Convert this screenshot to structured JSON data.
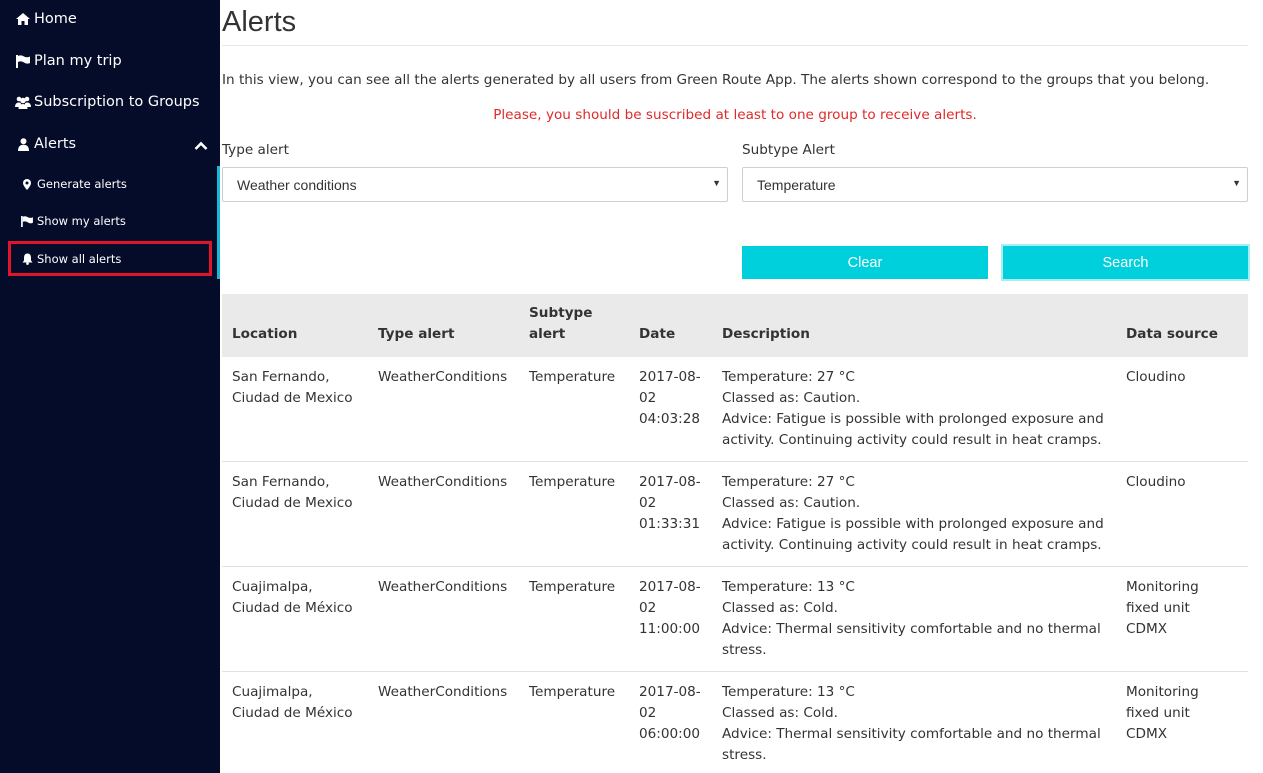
{
  "sidebar": {
    "home": "Home",
    "plan_trip": "Plan my trip",
    "subscription": "Subscription to Groups",
    "alerts": "Alerts",
    "sub_items": {
      "generate": "Generate alerts",
      "show_mine": "Show my alerts",
      "show_all": "Show all alerts"
    }
  },
  "page": {
    "title": "Alerts",
    "intro": "In this view, you can see all the alerts generated by all users from Green Route App. The alerts shown correspond to the groups that you belong.",
    "warning": "Please, you should be suscribed at least to one group to receive alerts."
  },
  "filters": {
    "type_label": "Type alert",
    "type_value": "Weather conditions",
    "subtype_label": "Subtype Alert",
    "subtype_value": "Temperature"
  },
  "buttons": {
    "clear": "Clear",
    "search": "Search"
  },
  "table": {
    "headers": {
      "location": "Location",
      "type": "Type alert",
      "subtype": "Subtype alert",
      "date": "Date",
      "description": "Description",
      "source": "Data source"
    },
    "rows": [
      {
        "loc1": "San Fernando,",
        "loc2": "Ciudad de Mexico",
        "type": "WeatherConditions",
        "subtype": "Temperature",
        "date1": "2017-08-",
        "date2": "02",
        "date3": "04:03:28",
        "d1": "Temperature: 27 °C",
        "d2": "Classed as: Caution.",
        "d3": "Advice: Fatigue is possible with prolonged exposure and",
        "d4": "activity. Continuing activity could result in heat cramps.",
        "src1": "Cloudino",
        "src2": "",
        "src3": ""
      },
      {
        "loc1": "San Fernando,",
        "loc2": "Ciudad de Mexico",
        "type": "WeatherConditions",
        "subtype": "Temperature",
        "date1": "2017-08-",
        "date2": "02",
        "date3": "01:33:31",
        "d1": "Temperature: 27 °C",
        "d2": "Classed as: Caution.",
        "d3": "Advice: Fatigue is possible with prolonged exposure and",
        "d4": "activity. Continuing activity could result in heat cramps.",
        "src1": "Cloudino",
        "src2": "",
        "src3": ""
      },
      {
        "loc1": "Cuajimalpa,",
        "loc2": "Ciudad de México",
        "type": "WeatherConditions",
        "subtype": "Temperature",
        "date1": "2017-08-",
        "date2": "02",
        "date3": "11:00:00",
        "d1": "Temperature: 13 °C",
        "d2": "Classed as: Cold.",
        "d3": "Advice: Thermal sensitivity comfortable and no thermal",
        "d4": "stress.",
        "src1": "Monitoring",
        "src2": "fixed unit",
        "src3": "CDMX"
      },
      {
        "loc1": "Cuajimalpa,",
        "loc2": "Ciudad de México",
        "type": "WeatherConditions",
        "subtype": "Temperature",
        "date1": "2017-08-",
        "date2": "02",
        "date3": "06:00:00",
        "d1": "Temperature: 13 °C",
        "d2": "Classed as: Cold.",
        "d3": "Advice: Thermal sensitivity comfortable and no thermal",
        "d4": "stress.",
        "src1": "Monitoring",
        "src2": "fixed unit",
        "src3": "CDMX"
      }
    ]
  },
  "icons": {
    "home": "home-icon",
    "plan_trip": "flag-icon",
    "subscription": "users-icon",
    "alerts": "user-icon",
    "alerts_toggle": "chevron-up-icon",
    "generate": "map-marker-icon",
    "show_mine": "flag-icon",
    "show_all": "bell-icon"
  },
  "colors": {
    "sidebar_bg": "#050c2a",
    "accent": "#00d0dc",
    "warning": "#e02a2a",
    "highlight": "#e0142a"
  }
}
